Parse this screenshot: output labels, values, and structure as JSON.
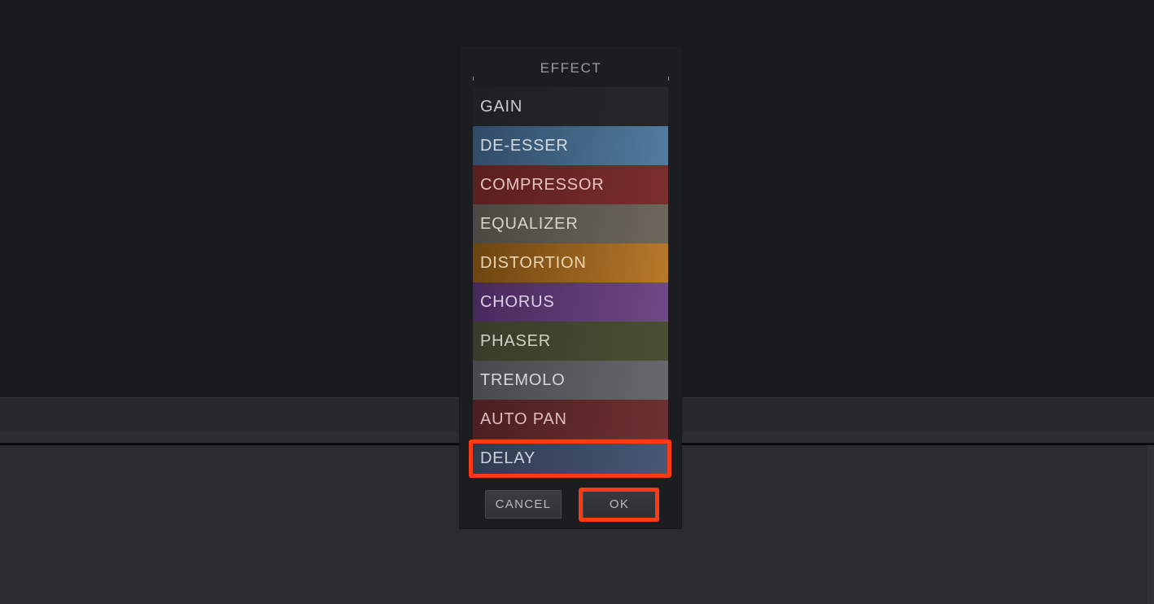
{
  "window": {
    "background_color": "#2a2c2f",
    "upper_surface_color": "#17191b"
  },
  "dialog": {
    "name": "effect-selection-dialog",
    "title": "EFFECT",
    "background_color": "#1b1d20",
    "border_color": "#8d8f92"
  },
  "effect_list": {
    "selected": "DELAY",
    "items": [
      {
        "label": "GAIN",
        "color_from": "#1e2023",
        "color_to": "#25272a",
        "text_color": "#c9cbce"
      },
      {
        "label": "DE-ESSER",
        "color_from": "#2f4b66",
        "color_to": "#527ca0",
        "text_color": "#d3dae1"
      },
      {
        "label": "COMPRESSOR",
        "color_from": "#5a1f1f",
        "color_to": "#7c2d2d",
        "text_color": "#e6c3c3"
      },
      {
        "label": "EQUALIZER",
        "color_from": "#4c4740",
        "color_to": "#6d675e",
        "text_color": "#d7d4cf"
      },
      {
        "label": "DISTORTION",
        "color_from": "#6b4410",
        "color_to": "#b9792a",
        "text_color": "#ecd5b0"
      },
      {
        "label": "CHORUS",
        "color_from": "#47285c",
        "color_to": "#6f4a86",
        "text_color": "#dccfe6"
      },
      {
        "label": "PHASER",
        "color_from": "#383c29",
        "color_to": "#4a4f34",
        "text_color": "#cfd2c6"
      },
      {
        "label": "TREMOLO",
        "color_from": "#47494c",
        "color_to": "#67696c",
        "text_color": "#d5d7da"
      },
      {
        "label": "AUTO PAN",
        "color_from": "#4a1f20",
        "color_to": "#6e3033",
        "text_color": "#e0bdbd"
      },
      {
        "label": "DELAY",
        "color_from": "#2f3a4e",
        "color_to": "#4a5875",
        "text_color": "#ccd2dd"
      }
    ]
  },
  "buttons": {
    "cancel_label": "CANCEL",
    "ok_label": "OK"
  },
  "annotations": {
    "highlight_color": "#fc3a13",
    "targets": [
      "DELAY",
      "OK"
    ]
  }
}
